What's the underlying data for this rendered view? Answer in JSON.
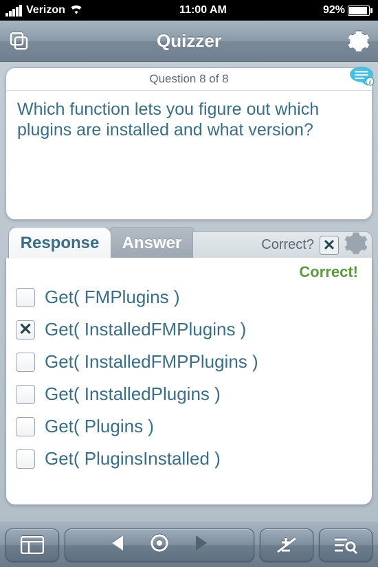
{
  "status": {
    "carrier": "Verizon",
    "time": "11:00 AM",
    "battery_pct": "92%"
  },
  "nav": {
    "title": "Quizzer"
  },
  "question": {
    "counter": "Question 8 of 8",
    "text": "Which function lets you figure out which plugins are installed and what version?"
  },
  "tabs": {
    "response": "Response",
    "answer": "Answer",
    "correct_label": "Correct?"
  },
  "feedback": "Correct!",
  "options": [
    {
      "label": "Get( FMPlugins )",
      "checked": false
    },
    {
      "label": "Get( InstalledFMPlugins )",
      "checked": true
    },
    {
      "label": "Get( InstalledFMPPlugins )",
      "checked": false
    },
    {
      "label": "Get( InstalledPlugins )",
      "checked": false
    },
    {
      "label": "Get( Plugins )",
      "checked": false
    },
    {
      "label": "Get( PluginsInstalled )",
      "checked": false
    }
  ]
}
